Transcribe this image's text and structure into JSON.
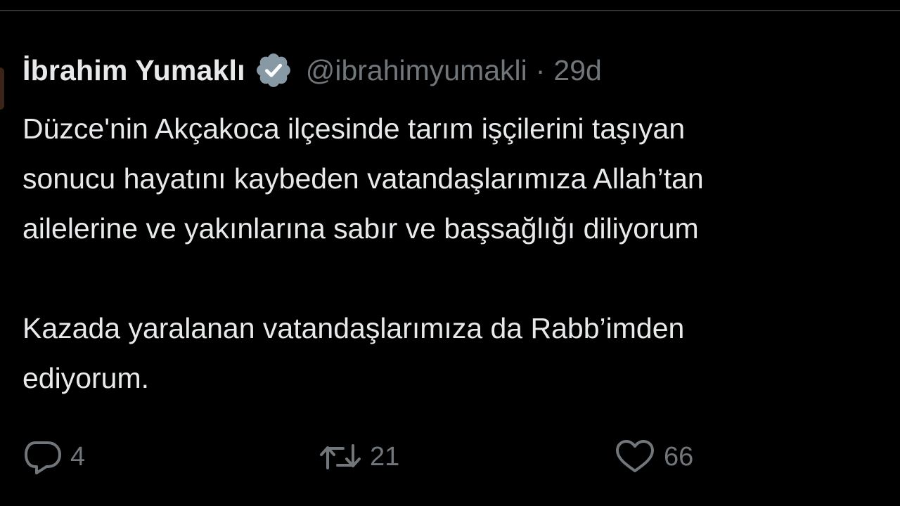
{
  "tweet": {
    "display_name": "İbrahim Yumaklı",
    "verified_icon": "verified-badge-icon",
    "verified_color": "#8899a6",
    "handle": "@ibrahimyumakli",
    "separator": "·",
    "time": "29d",
    "body_lines": [
      "Düzce'nin Akçakoca ilçesinde tarım işçilerini taşıyan",
      "sonucu hayatını kaybeden vatandaşlarımıza Allah’tan",
      "ailelerine ve yakınlarına sabır ve başsağlığı diliyorum",
      "Kazada yaralanan vatandaşlarımıza da Rabb’imden",
      "ediyorum."
    ]
  },
  "actions": {
    "reply": {
      "icon": "reply-icon",
      "count": "4"
    },
    "retweet": {
      "icon": "retweet-icon",
      "count": "21"
    },
    "like": {
      "icon": "heart-icon",
      "count": "66"
    }
  },
  "colors": {
    "background": "#000000",
    "text_primary": "#e7e9ea",
    "text_secondary": "#71767b"
  }
}
